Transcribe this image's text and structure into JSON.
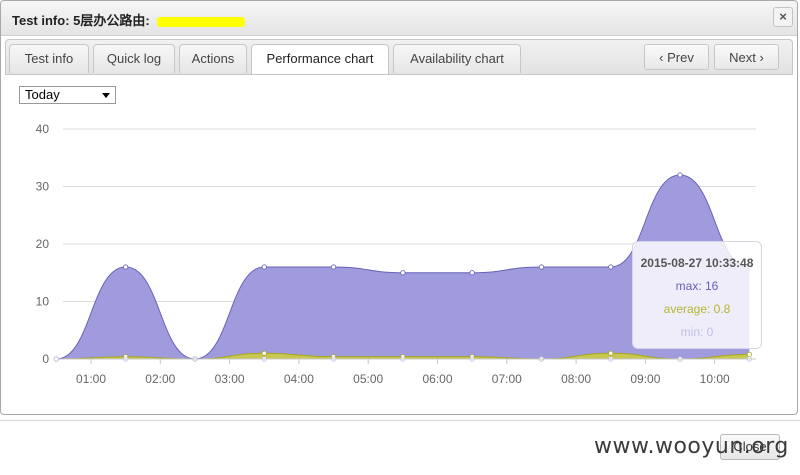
{
  "dialog": {
    "title_prefix": "Test info: 5层办公路由: ",
    "close_glyph": "×"
  },
  "tabs": [
    {
      "label": "Test info",
      "active": false
    },
    {
      "label": "Quick log",
      "active": false
    },
    {
      "label": "Actions",
      "active": false
    },
    {
      "label": "Performance chart",
      "active": true
    },
    {
      "label": "Availability chart",
      "active": false
    }
  ],
  "nav": {
    "prev_label": "‹  Prev",
    "next_label": "Next  ›"
  },
  "range_select": {
    "value": "Today"
  },
  "tooltip": {
    "title": "2015-08-27 10:33:48",
    "max_label": "max: 16",
    "avg_label": "average: 0.8",
    "min_label": "min: 0"
  },
  "footer": {
    "close_label": "Close",
    "watermark": "www.wooyun.org"
  },
  "colors": {
    "max_fill": "#9f9bdc",
    "max_line": "#6662b8",
    "avg_fill": "#c9c94a",
    "min_color": "#c0c0e8",
    "grid": "#dcdcdc",
    "axis_text": "#666666"
  },
  "chart_data": {
    "type": "area",
    "title": "",
    "xlabel": "",
    "ylabel": "",
    "ylim": [
      0,
      40
    ],
    "yticks": [
      "0",
      "10",
      "20",
      "30",
      "40"
    ],
    "xticks": [
      "01:00",
      "02:00",
      "03:00",
      "04:00",
      "05:00",
      "06:00",
      "07:00",
      "08:00",
      "09:00",
      "10:00"
    ],
    "x": [
      0.5,
      1.5,
      2.5,
      3.5,
      4.5,
      5.5,
      6.5,
      7.5,
      8.5,
      9.5,
      10.5
    ],
    "series": [
      {
        "name": "max",
        "values": [
          0,
          16,
          0,
          16,
          16,
          15,
          15,
          16,
          16,
          32,
          16
        ]
      },
      {
        "name": "average",
        "values": [
          0,
          0.4,
          0,
          1.0,
          0.4,
          0.4,
          0.4,
          0,
          1.0,
          0,
          0.8
        ]
      },
      {
        "name": "min",
        "values": [
          0,
          0,
          0,
          0,
          0,
          0,
          0,
          0,
          0,
          0,
          0
        ]
      }
    ]
  }
}
